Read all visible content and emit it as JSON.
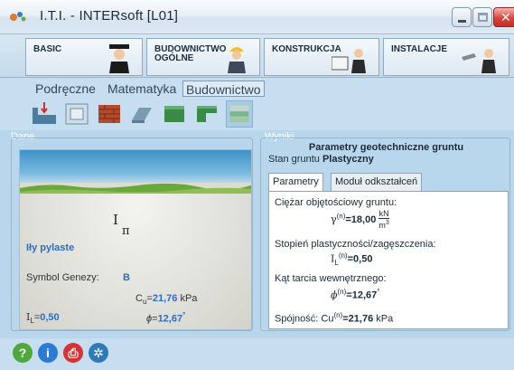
{
  "window": {
    "title": "I.T.I. - INTERsoft [L01]"
  },
  "main_tabs": [
    {
      "label": "BASIC"
    },
    {
      "label": "BUDOWNICTWO OGÓLNE"
    },
    {
      "label": "KONSTRUKCJA"
    },
    {
      "label": "INSTALACJE"
    }
  ],
  "sub_tabs": [
    {
      "label": "Podręczne"
    },
    {
      "label": "Matematyka"
    },
    {
      "label": "Budownictwo"
    }
  ],
  "active_sub_tab": "Budownictwo",
  "dane": {
    "label": "Dane",
    "soil_symbol": "I",
    "soil_symbol_sub": "π",
    "soil_name": "Iły pylaste",
    "genesis_label": "Symbol Genezy:",
    "genesis_value": "B",
    "il_label": "I",
    "il_sub": "L",
    "il_eq": "=",
    "il_value": "0,50",
    "cu_label": "C",
    "cu_sub": "u",
    "cu_eq": "=",
    "cu_value": "21,76",
    "cu_unit": "kPa",
    "phi_label": "ϕ",
    "phi_eq": "=",
    "phi_value": "12,67",
    "phi_unit": "°"
  },
  "wyniki": {
    "label": "Wyniki",
    "title": "Parametry geotechniczne gruntu",
    "stan_label": "Stan gruntu",
    "stan_value": "Plastyczny",
    "tabs": [
      {
        "label": "Parametry"
      },
      {
        "label": "Moduł odkształceń"
      }
    ],
    "rows": {
      "ciezar_label": "Ciężar objętościowy gruntu:",
      "ciezar_symbol": "γ",
      "ciezar_sup": "(n)",
      "ciezar_eq": "=",
      "ciezar_value": "18,00",
      "ciezar_unit_num": "kN",
      "ciezar_unit_den": "m",
      "ciezar_unit_den_exp": "3",
      "stopien_label": "Stopień plastyczności/zagęszczenia:",
      "stopien_symbol": "I",
      "stopien_sup": "(n)",
      "stopien_sub": "L",
      "stopien_eq": "=",
      "stopien_value": "0,50",
      "kat_label": "Kąt tarcia wewnętrznego:",
      "kat_symbol": "ϕ",
      "kat_sup": "(n)",
      "kat_eq": "=",
      "kat_value": "12,67",
      "kat_unit": "°",
      "spojnosc_label": "Spójność:",
      "spojnosc_symbol": "Cu",
      "spojnosc_sup": "(n)",
      "spojnosc_eq": "=",
      "spojnosc_value": "21,76",
      "spojnosc_unit": "kPa"
    }
  },
  "toolbar": {
    "icons": [
      "pressure-icon",
      "foundation-icon",
      "brick-wall-icon",
      "slab-icon",
      "green-block-icon",
      "green-l-block-icon",
      "soil-layers-icon"
    ]
  },
  "bottom_icons": [
    "help-icon",
    "info-icon",
    "print-icon",
    "tools-icon"
  ]
}
